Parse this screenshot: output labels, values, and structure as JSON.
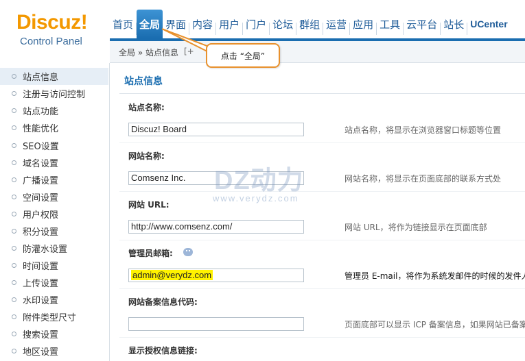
{
  "logo": {
    "main": "Discuz!",
    "sub": "Control Panel"
  },
  "nav": {
    "items": [
      "首页",
      "全局",
      "界面",
      "内容",
      "用户",
      "门户",
      "论坛",
      "群组",
      "运营",
      "应用",
      "工具",
      "云平台",
      "站长",
      "UCenter"
    ],
    "active": "全局"
  },
  "breadcrumb": {
    "path": "全局 » 站点信息",
    "extra": "[+"
  },
  "callout": {
    "text": "点击 “全局”"
  },
  "sidebar": {
    "items": [
      "站点信息",
      "注册与访问控制",
      "站点功能",
      "性能优化",
      "SEO设置",
      "域名设置",
      "广播设置",
      "空间设置",
      "用户权限",
      "积分设置",
      "防灌水设置",
      "时间设置",
      "上传设置",
      "水印设置",
      "附件类型尺寸",
      "搜索设置",
      "地区设置"
    ]
  },
  "main": {
    "title": "站点信息",
    "fields": [
      {
        "label": "站点名称:",
        "value": "Discuz! Board",
        "desc": "站点名称，将显示在浏览器窗口标题等位置"
      },
      {
        "label": "网站名称:",
        "value": "Comsenz Inc.",
        "desc": "网站名称，将显示在页面底部的联系方式处"
      },
      {
        "label": "网站 URL:",
        "value": "http://www.comsenz.com/",
        "desc": "网站 URL，将作为链接显示在页面底部"
      },
      {
        "label": "管理员邮箱:",
        "value": "admin@verydz.com",
        "desc": "管理员 E-mail，将作为系统发邮件的时候的发件人"
      },
      {
        "label": "网站备案信息代码:",
        "value": "",
        "desc": "页面底部可以显示 ICP 备案信息，如果网站已备案"
      },
      {
        "label": "显示授权信息链接:",
        "value": "",
        "desc": ""
      }
    ]
  },
  "watermark": {
    "main": "DZ动力",
    "sub": "www.verydz.com"
  },
  "colors": {
    "accent": "#1a6db0",
    "logo": "#f39800",
    "callout_border": "#e8912d",
    "highlight": "#fff200"
  }
}
